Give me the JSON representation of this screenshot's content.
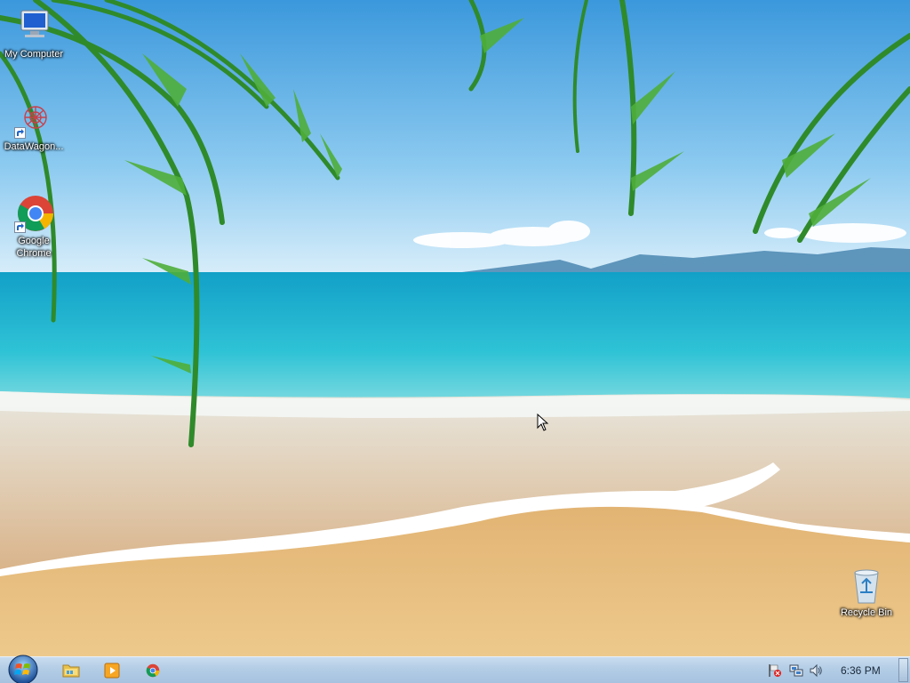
{
  "desktop": {
    "icons": [
      {
        "label": "My Computer",
        "icon": "computer-icon"
      },
      {
        "label": "DataWagon...",
        "icon": "datawagon-icon"
      },
      {
        "label": "Google Chrome",
        "icon": "chrome-icon"
      },
      {
        "label": "Recycle Bin",
        "icon": "recycle-bin-icon"
      }
    ]
  },
  "taskbar": {
    "start_icon": "windows-logo-icon",
    "pinned": [
      {
        "icon": "folder-icon"
      },
      {
        "icon": "media-player-icon"
      },
      {
        "icon": "chrome-icon"
      }
    ],
    "tray": {
      "icons": [
        "action-center-flag-icon",
        "network-icon",
        "volume-icon"
      ],
      "clock": "6:36 PM"
    }
  },
  "colors": {
    "sky": "#5aaee6",
    "sea": "#1fb3cf",
    "sand": "#e9bf7a",
    "taskbar": "#b3cde6"
  }
}
